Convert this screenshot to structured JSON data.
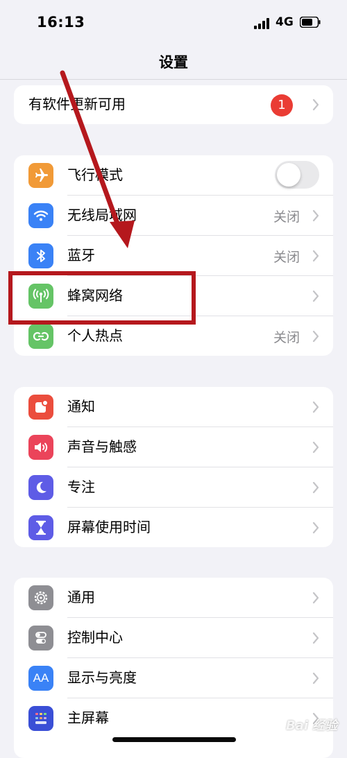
{
  "status_bar": {
    "time": "16:13",
    "network": "4G"
  },
  "nav": {
    "title": "设置"
  },
  "update_group": {
    "label": "有软件更新可用",
    "badge": "1"
  },
  "connectivity_group": [
    {
      "label": "飞行模式",
      "icon": "airplane-icon",
      "color": "#f19a37",
      "toggle": false
    },
    {
      "label": "无线局域网",
      "icon": "wifi-icon",
      "color": "#3a82f6",
      "value": "关闭"
    },
    {
      "label": "蓝牙",
      "icon": "bluetooth-icon",
      "color": "#3a82f6",
      "value": "关闭"
    },
    {
      "label": "蜂窝网络",
      "icon": "cellular-icon",
      "color": "#65c466",
      "value": ""
    },
    {
      "label": "个人热点",
      "icon": "hotspot-icon",
      "color": "#65c466",
      "value": "关闭"
    }
  ],
  "notification_group": [
    {
      "label": "通知",
      "icon": "notification-icon",
      "color": "#eb4d3d"
    },
    {
      "label": "声音与触感",
      "icon": "sound-icon",
      "color": "#eb445a"
    },
    {
      "label": "专注",
      "icon": "moon-icon",
      "color": "#5e5ce6"
    },
    {
      "label": "屏幕使用时间",
      "icon": "hourglass-icon",
      "color": "#5e5ce6"
    }
  ],
  "general_group": [
    {
      "label": "通用",
      "icon": "gear-icon",
      "color": "#8e8e93"
    },
    {
      "label": "控制中心",
      "icon": "control-center-icon",
      "color": "#8e8e93"
    },
    {
      "label": "显示与亮度",
      "icon": "display-icon",
      "color": "#3a82f6",
      "icon_text": "AA"
    },
    {
      "label": "主屏幕",
      "icon": "home-screen-icon",
      "color": "#3a4fd6"
    }
  ],
  "annotation": {
    "color": "#b5181d"
  },
  "watermark": {
    "text": "Bai 经验"
  }
}
